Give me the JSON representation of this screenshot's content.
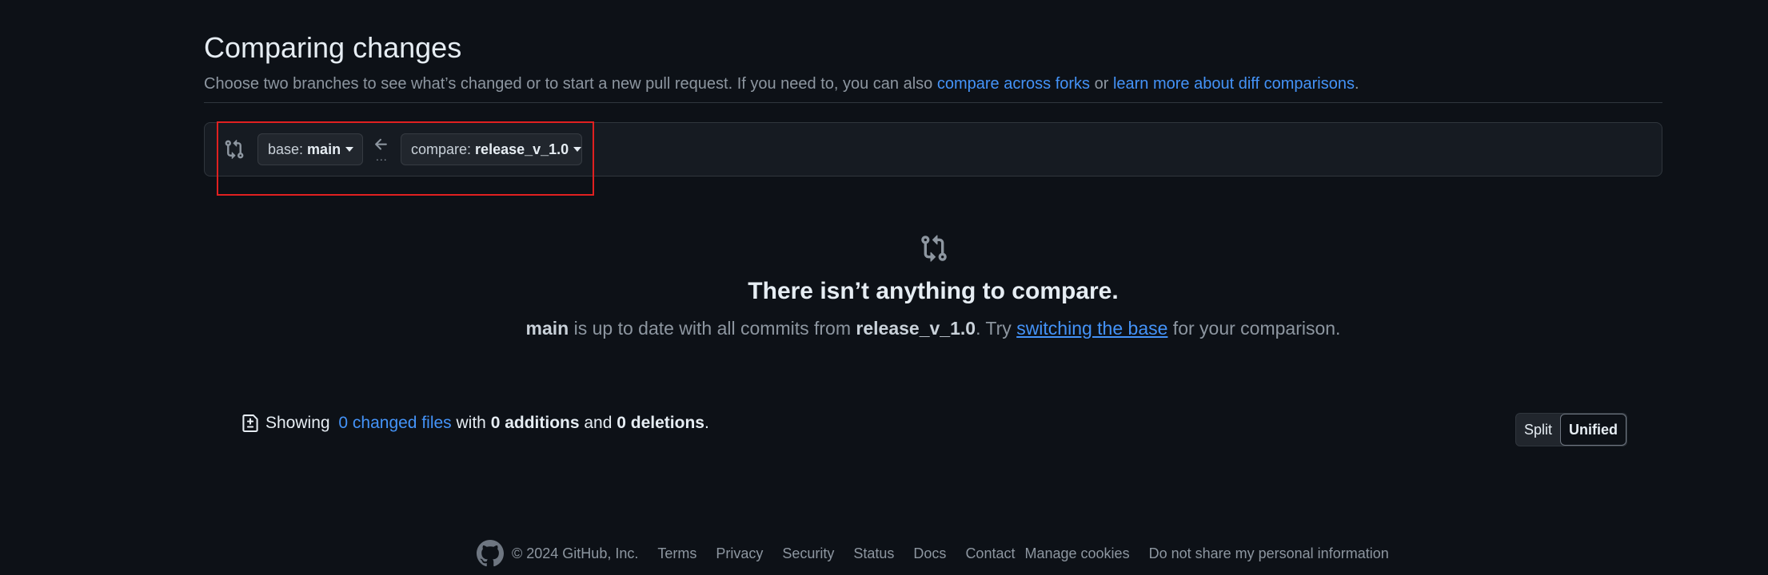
{
  "header": {
    "title": "Comparing changes",
    "subtitle_prefix": "Choose two branches to see what’s changed or to start a new pull request. If you need to, you can also ",
    "link_forks": "compare across forks",
    "subtitle_or": " or ",
    "link_learn": "learn more about diff comparisons",
    "subtitle_end": "."
  },
  "range": {
    "base_prefix": "base: ",
    "base_branch": "main",
    "compare_prefix": "compare: ",
    "compare_branch": "release_v_1.0",
    "dots": "..."
  },
  "blankslate": {
    "title": "There isn’t anything to compare.",
    "base": "main",
    "text1": " is up to date with all commits from ",
    "compare": "release_v_1.0",
    "text2": ". Try ",
    "link": "switching the base",
    "text3": " for your comparison."
  },
  "toc": {
    "showing": "Showing ",
    "changed_files": "0 changed files",
    "with": " with ",
    "additions": "0 additions",
    "and": " and ",
    "deletions": "0 deletions",
    "end": "."
  },
  "view_toggle": {
    "split": "Split",
    "unified": "Unified",
    "selected": "Unified"
  },
  "footer": {
    "copyright": "© 2024 GitHub, Inc.",
    "links": [
      "Terms",
      "Privacy",
      "Security",
      "Status",
      "Docs",
      "Contact",
      "Manage cookies",
      "Do not share my personal information"
    ]
  },
  "colors": {
    "background": "#0d1117",
    "link": "#4493f8",
    "highlight": "#e02020"
  }
}
